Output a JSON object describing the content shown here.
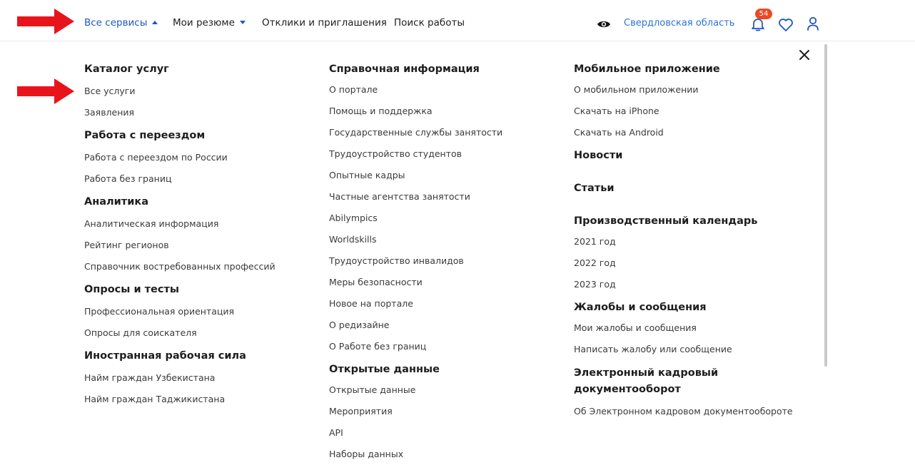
{
  "header": {
    "nav": [
      {
        "label": "Все сервисы",
        "expanded": true
      },
      {
        "label": "Мои резюме",
        "expanded": false
      },
      {
        "label": "Отклики и приглашения"
      },
      {
        "label": "Поиск работы"
      }
    ],
    "region": "Свердловская область",
    "notifications_count": "54",
    "accent_color": "#1f57c3",
    "badge_color": "#e94b22",
    "icons": [
      "eye-icon",
      "bell-icon",
      "heart-icon",
      "user-icon"
    ]
  },
  "menu": {
    "close_icon": "close-icon",
    "columns": [
      {
        "groups": [
          {
            "heading": "Каталог услуг",
            "links": [
              "Все услуги",
              "Заявления"
            ]
          },
          {
            "heading": "Работа с переездом",
            "links": [
              "Работа с переездом по России",
              "Работа без границ"
            ]
          },
          {
            "heading": "Аналитика",
            "links": [
              "Аналитическая информация",
              "Рейтинг регионов",
              "Справочник востребованных профессий"
            ]
          },
          {
            "heading": "Опросы и тесты",
            "links": [
              "Профессиональная ориентация",
              "Опросы для соискателя"
            ]
          },
          {
            "heading": "Иностранная рабочая сила",
            "links": [
              "Найм граждан Узбекистана",
              "Найм граждан Таджикистана"
            ]
          }
        ]
      },
      {
        "groups": [
          {
            "heading": "Справочная информация",
            "links": [
              "О портале",
              "Помощь и поддержка",
              "Государственные службы занятости",
              "Трудоустройство студентов",
              "Опытные кадры",
              "Частные агентства занятости",
              "Abilympics",
              "Worldskills",
              "Трудоустройство инвалидов",
              "Меры безопасности",
              "Новое на портале",
              "О редизайне",
              "О Работе без границ"
            ]
          },
          {
            "heading": "Открытые данные",
            "links": [
              "Открытые данные",
              "Мероприятия",
              "API",
              "Наборы данных"
            ]
          }
        ]
      },
      {
        "groups": [
          {
            "heading": "Мобильное приложение",
            "links": [
              "О мобильном приложении",
              "Скачать на iPhone",
              "Скачать на Android"
            ]
          },
          {
            "heading": "Новости",
            "links": []
          },
          {
            "heading": "Статьи",
            "links": []
          },
          {
            "heading": "Производственный календарь",
            "links": [
              "2021 год",
              "2022 год",
              "2023 год"
            ]
          },
          {
            "heading": "Жалобы и сообщения",
            "links": [
              "Мои жалобы и сообщения",
              "Написать жалобу или сообщение"
            ]
          },
          {
            "heading": "Электронный кадровый документооборот",
            "links": [
              "Об Электронном кадровом документообороте"
            ]
          }
        ]
      }
    ]
  },
  "annotations": {
    "arrow_color": "#e8141c"
  }
}
